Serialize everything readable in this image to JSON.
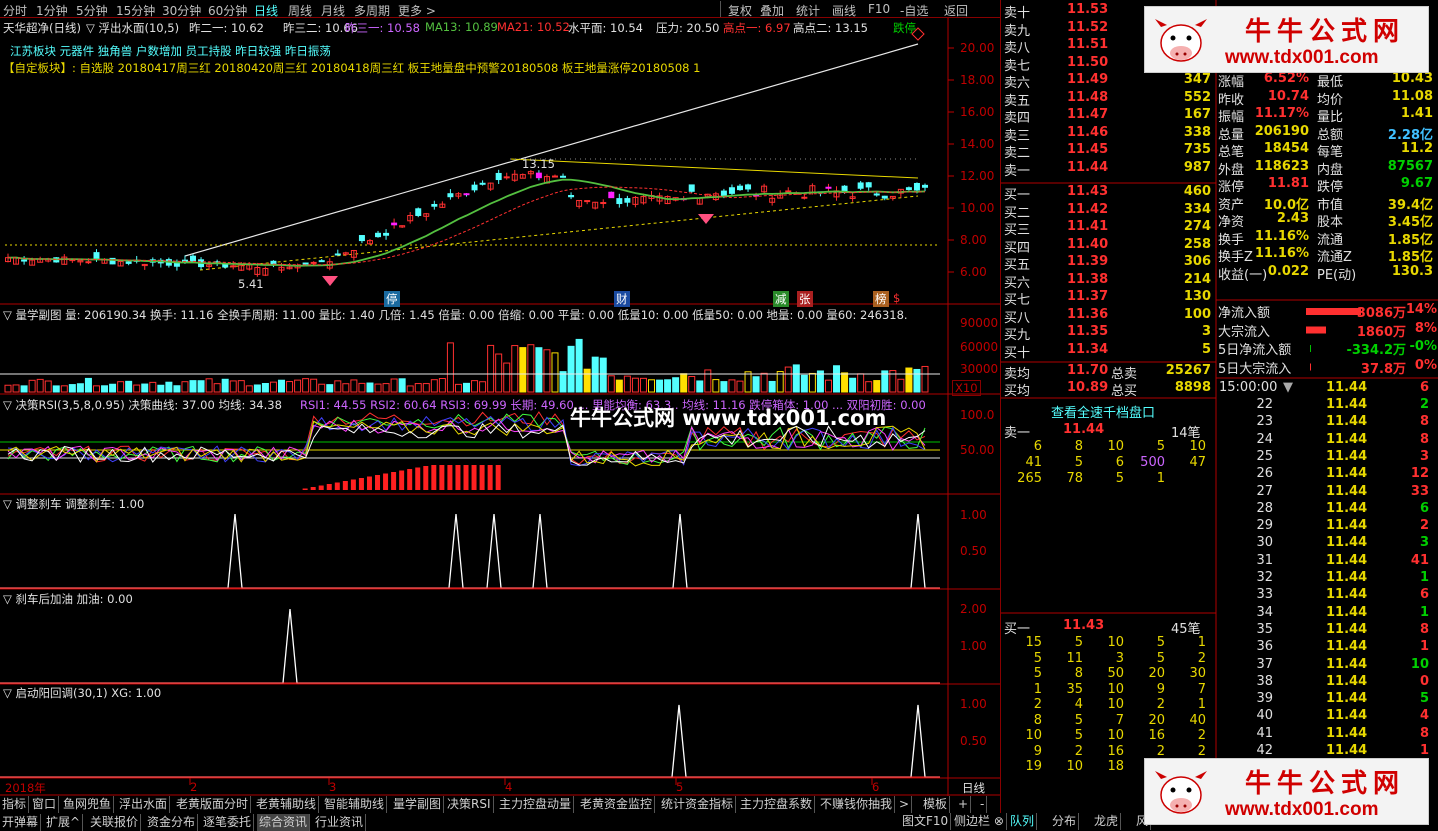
{
  "toolbar": {
    "periods": [
      "分时",
      "1分钟",
      "5分钟",
      "15分钟",
      "30分钟",
      "60分钟",
      "日线",
      "周线",
      "月线",
      "多周期",
      "更多 >"
    ],
    "buttons": [
      "复权",
      "叠加",
      "统计",
      "画线",
      "F10",
      "-自选",
      "返回"
    ]
  },
  "header": {
    "stock": "天华超净(日线)",
    "formula": "▽ 浮出水面(10,5)",
    "z2": "昨二一: 10.62",
    "z3": "昨三二: 10.66",
    "z31": "昨三一: 10.58",
    "ma13": "MA13: 10.89",
    "ma21": "MA21: 10.52",
    "shui": "水平面: 10.54",
    "ya": "压力: 20.50",
    "g1": "高点一: 6.97",
    "g2": "高点二: 13.15",
    "die": "跌停",
    "line2": "江苏板块 元器件 独角兽 户数增加 员工持股 昨日较强 昨日振荡",
    "line3": "【自定板块】: 自选股 20180417周三红 20180420周三红 20180418周三红 板王地量盘中预警20180508 板王地量涨停20180508 1"
  },
  "main_axis": [
    "20.00",
    "18.00",
    "16.00",
    "14.00",
    "12.00",
    "10.00",
    "8.00",
    "6.00"
  ],
  "main_labels": {
    "hi": "13.15",
    "lo": "5.41",
    "l1": "停",
    "l2": "财",
    "l3": "减",
    "l4": "张",
    "l5": "榜",
    "l6": "$"
  },
  "vol_pane": {
    "title": "▽ 量学副图  量: 206190.34  换手: 11.16  全换手周期: 11.00  量比: 1.40  几倍: 1.45  倍量: 0.00  倍缩: 0.00  平量: 0.00  低量10: 0.00  低量50: 0.00  地量: 0.00  量60: 246318.",
    "axis": [
      "90000",
      "60000",
      "30000"
    ],
    "unit": "X10"
  },
  "rsi_pane": {
    "title1": "▽ 决策RSI(3,5,8,0.95)  决策曲线: 37.00  均线: 34.38",
    "title2": "RSI1: 44.55  RSI2: 60.64  RSI3: 69.99  长期: 49.60  ...  里能均衡: 63.3..  均线: 11.16  跌停箱体: 1.00  ...  双阳初胜: 0.00",
    "axis": [
      "100.0",
      "50.00"
    ],
    "watermark": "牛牛公式网  www.tdx001.com"
  },
  "brake_pane": {
    "title": "▽ 调整刹车  调整刹车: 1.00",
    "axis": [
      "1.00",
      "0.50"
    ]
  },
  "fuel_pane": {
    "title": "▽ 刹车后加油  加油: 0.00",
    "axis": [
      "2.00",
      "1.00"
    ]
  },
  "start_pane": {
    "title": "▽ 启动阳回调(30,1)  XG: 1.00",
    "axis": [
      "1.00",
      "0.50"
    ]
  },
  "xaxis": {
    "labels": [
      "2018年",
      "2",
      "3",
      "4",
      "5",
      "6"
    ],
    "period": "日线"
  },
  "bottom_tabs": [
    "指标",
    "窗口",
    "鱼网兜鱼",
    "浮出水面",
    "老黄版面分时",
    "老黄辅助线",
    "智能辅助线",
    "量学副图",
    "决策RSI",
    "主力控盘动量",
    "老黄资金监控",
    "统计资金指标",
    "主力控盘系数",
    "不赚钱你抽我",
    ">",
    "模板",
    "+",
    "-"
  ],
  "bottom_tabs2": [
    "开弹幕",
    "扩展^",
    "关联报价",
    "资金分布",
    "逐笔委托",
    "综合资讯",
    "行业资讯"
  ],
  "right_bottom_tabs": [
    "图文F10",
    "侧边栏 ⊗",
    "队列",
    "分布",
    "龙虎",
    "风"
  ],
  "sell_orders": [
    {
      "l": "卖十",
      "p": "11.53",
      "v": ""
    },
    {
      "l": "卖九",
      "p": "11.52",
      "v": ""
    },
    {
      "l": "卖八",
      "p": "11.51",
      "v": ""
    },
    {
      "l": "卖七",
      "p": "11.50",
      "v": ""
    },
    {
      "l": "卖六",
      "p": "11.49",
      "v": "347"
    },
    {
      "l": "卖五",
      "p": "11.48",
      "v": "552"
    },
    {
      "l": "卖四",
      "p": "11.47",
      "v": "167"
    },
    {
      "l": "卖三",
      "p": "11.46",
      "v": "338"
    },
    {
      "l": "卖二",
      "p": "11.45",
      "v": "735"
    },
    {
      "l": "卖一",
      "p": "11.44",
      "v": "987"
    }
  ],
  "buy_orders": [
    {
      "l": "买一",
      "p": "11.43",
      "v": "460"
    },
    {
      "l": "买二",
      "p": "11.42",
      "v": "334"
    },
    {
      "l": "买三",
      "p": "11.41",
      "v": "274"
    },
    {
      "l": "买四",
      "p": "11.40",
      "v": "258"
    },
    {
      "l": "买五",
      "p": "11.39",
      "v": "306"
    },
    {
      "l": "买六",
      "p": "11.38",
      "v": "214"
    },
    {
      "l": "买七",
      "p": "11.37",
      "v": "130"
    },
    {
      "l": "买八",
      "p": "11.36",
      "v": "100"
    },
    {
      "l": "买九",
      "p": "11.35",
      "v": "3"
    },
    {
      "l": "买十",
      "p": "11.34",
      "v": "5"
    }
  ],
  "avg": {
    "sell_l": "卖均",
    "sell_p": "11.70",
    "sell_tl": "总卖",
    "sell_tv": "25267",
    "buy_l": "买均",
    "buy_p": "10.89",
    "buy_tl": "总买",
    "buy_tv": "8898"
  },
  "thousand_btn": "查看全速千档盘口",
  "queue_sell": {
    "label": "卖一",
    "price": "11.44",
    "count": "14笔",
    "rows": [
      [
        "6",
        "8",
        "10",
        "5",
        "10"
      ],
      [
        "41",
        "5",
        "6",
        "500",
        "47"
      ],
      [
        "265",
        "78",
        "5",
        "1",
        ""
      ]
    ]
  },
  "queue_buy": {
    "label": "买一",
    "price": "11.43",
    "count": "45笔",
    "rows": [
      [
        "15",
        "5",
        "10",
        "5",
        "1"
      ],
      [
        "5",
        "11",
        "3",
        "5",
        "2"
      ],
      [
        "5",
        "8",
        "50",
        "20",
        "30"
      ],
      [
        "1",
        "35",
        "10",
        "9",
        "7"
      ],
      [
        "2",
        "4",
        "10",
        "2",
        "1"
      ],
      [
        "8",
        "5",
        "7",
        "20",
        "40"
      ],
      [
        "10",
        "5",
        "10",
        "16",
        "2"
      ],
      [
        "9",
        "2",
        "16",
        "2",
        "2"
      ],
      [
        "19",
        "10",
        "18",
        "",
        ""
      ]
    ]
  },
  "quote": [
    [
      "涨幅",
      "6.52%",
      "最低",
      "10.43"
    ],
    [
      "昨收",
      "10.74",
      "均价",
      "11.08"
    ],
    [
      "振幅",
      "11.17%",
      "量比",
      "1.41"
    ],
    [
      "总量",
      "206190",
      "总额",
      "2.28亿"
    ],
    [
      "总笔",
      "18454",
      "每笔",
      "11.2"
    ],
    [
      "外盘",
      "118623",
      "内盘",
      "87567"
    ],
    [
      "涨停",
      "11.81",
      "跌停",
      "9.67"
    ],
    [
      "资产",
      "10.0亿",
      "市值",
      "39.4亿"
    ],
    [
      "净资",
      "2.43",
      "股本",
      "3.45亿"
    ],
    [
      "换手",
      "11.16%",
      "流通",
      "1.85亿"
    ],
    [
      "换手Z",
      "11.16%",
      "流通Z",
      "1.85亿"
    ],
    [
      "收益(一)",
      "0.022",
      "PE(动)",
      "130.3"
    ]
  ],
  "flows": [
    {
      "l": "净流入额",
      "v": "3086万",
      "p": "14%"
    },
    {
      "l": "大宗流入",
      "v": "1860万",
      "p": "8%"
    },
    {
      "l": "5日净流入额",
      "v": "-334.2万",
      "p": "-0%"
    },
    {
      "l": "5日大宗流入",
      "v": "37.8万",
      "p": "0%"
    }
  ],
  "ticks_head": {
    "time": "15:00:00",
    "mark": "▼",
    "price": "11.44",
    "vol": "6"
  },
  "ticks": [
    [
      "22",
      "11.44",
      "2"
    ],
    [
      "23",
      "11.44",
      "8"
    ],
    [
      "24",
      "11.44",
      "8"
    ],
    [
      "25",
      "11.44",
      "3"
    ],
    [
      "26",
      "11.44",
      "12"
    ],
    [
      "27",
      "11.44",
      "33"
    ],
    [
      "28",
      "11.44",
      "6"
    ],
    [
      "29",
      "11.44",
      "2"
    ],
    [
      "30",
      "11.44",
      "3"
    ],
    [
      "31",
      "11.44",
      "41"
    ],
    [
      "32",
      "11.44",
      "1"
    ],
    [
      "33",
      "11.44",
      "6"
    ],
    [
      "34",
      "11.44",
      "1"
    ],
    [
      "35",
      "11.44",
      "8"
    ],
    [
      "36",
      "11.44",
      "1"
    ],
    [
      "37",
      "11.44",
      "10"
    ],
    [
      "38",
      "11.44",
      "0"
    ],
    [
      "39",
      "11.44",
      "5"
    ],
    [
      "40",
      "11.44",
      "4"
    ],
    [
      "41",
      "11.44",
      "8"
    ],
    [
      "42",
      "11.44",
      "1"
    ]
  ],
  "logo": {
    "cn": "牛牛公式网",
    "url": "www.tdx001.com"
  },
  "colors": {
    "up": "#ff3030",
    "down": "#54ffff",
    "axis": "#c00000",
    "ma_green": "#54c040",
    "yellow": "#e8d800"
  }
}
